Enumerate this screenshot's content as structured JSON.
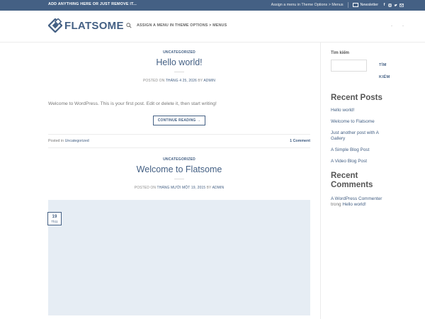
{
  "topbar": {
    "left_text": "ADD ANYTHING HERE OR JUST REMOVE IT...",
    "menu_hint": "Assign a menu in Theme Options > Menus",
    "newsletter": "Newsletter",
    "social_icons": [
      "facebook-icon",
      "instagram-icon",
      "twitter-icon",
      "email-icon"
    ],
    "bg_color": "#446084"
  },
  "header": {
    "logo_text": "FLATSOME",
    "nav_menu_text": "ASSIGN A MENU IN THEME OPTIONS > MENUS",
    "right_icons": [
      "-",
      "-"
    ]
  },
  "posts": [
    {
      "category": "UNCATEGORIZED",
      "title": "Hello world!",
      "meta_prefix": "POSTED ON",
      "meta_date": "THÁNG 4 25, 2026",
      "meta_by": "BY",
      "meta_author": "ADMIN",
      "excerpt": "Welcome to WordPress. This is your first post. Edit or delete it, then start writing!",
      "continue_label": "CONTINUE READING →",
      "footer_posted_in": "Posted in",
      "footer_category": "Uncategorized",
      "footer_comments": "1 Comment"
    },
    {
      "category": "UNCATEGORIZED",
      "title": "Welcome to Flatsome",
      "meta_prefix": "POSTED ON",
      "meta_date": "THÁNG MƯỜI MỘT 19, 2015",
      "meta_by": "BY",
      "meta_author": "ADMIN",
      "date_badge_day": "19",
      "date_badge_month": "Th11"
    }
  ],
  "sidebar": {
    "search_label": "Tìm kiếm",
    "search_btn_1": "TÌM",
    "search_btn_2": "KIẾM",
    "recent_posts_title": "Recent Posts",
    "recent_posts": [
      "Hello world!",
      "Welcome to Flatsome",
      "Just another post with A Gallery",
      "A Simple Blog Post",
      "A Video Blog Post"
    ],
    "recent_comments_title": "Recent Comments",
    "comment_author": "A WordPress Commenter",
    "comment_on": "trong",
    "comment_post": "Hello world!"
  },
  "colors": {
    "primary": "#446084",
    "text": "#777777",
    "featured_bg": "#e6edf4"
  }
}
